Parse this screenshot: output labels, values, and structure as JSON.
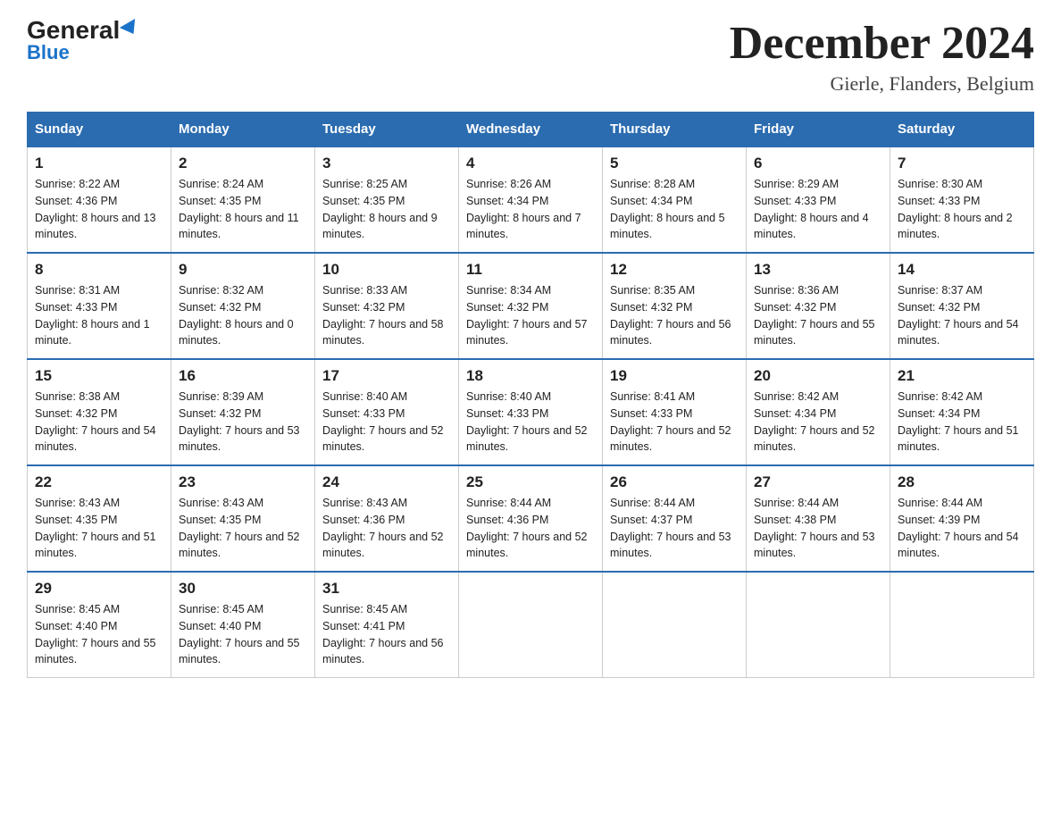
{
  "logo": {
    "general": "General",
    "blue": "Blue"
  },
  "title": "December 2024",
  "subtitle": "Gierle, Flanders, Belgium",
  "days_of_week": [
    "Sunday",
    "Monday",
    "Tuesday",
    "Wednesday",
    "Thursday",
    "Friday",
    "Saturday"
  ],
  "weeks": [
    [
      {
        "day": "1",
        "sunrise": "8:22 AM",
        "sunset": "4:36 PM",
        "daylight": "8 hours and 13 minutes."
      },
      {
        "day": "2",
        "sunrise": "8:24 AM",
        "sunset": "4:35 PM",
        "daylight": "8 hours and 11 minutes."
      },
      {
        "day": "3",
        "sunrise": "8:25 AM",
        "sunset": "4:35 PM",
        "daylight": "8 hours and 9 minutes."
      },
      {
        "day": "4",
        "sunrise": "8:26 AM",
        "sunset": "4:34 PM",
        "daylight": "8 hours and 7 minutes."
      },
      {
        "day": "5",
        "sunrise": "8:28 AM",
        "sunset": "4:34 PM",
        "daylight": "8 hours and 5 minutes."
      },
      {
        "day": "6",
        "sunrise": "8:29 AM",
        "sunset": "4:33 PM",
        "daylight": "8 hours and 4 minutes."
      },
      {
        "day": "7",
        "sunrise": "8:30 AM",
        "sunset": "4:33 PM",
        "daylight": "8 hours and 2 minutes."
      }
    ],
    [
      {
        "day": "8",
        "sunrise": "8:31 AM",
        "sunset": "4:33 PM",
        "daylight": "8 hours and 1 minute."
      },
      {
        "day": "9",
        "sunrise": "8:32 AM",
        "sunset": "4:32 PM",
        "daylight": "8 hours and 0 minutes."
      },
      {
        "day": "10",
        "sunrise": "8:33 AM",
        "sunset": "4:32 PM",
        "daylight": "7 hours and 58 minutes."
      },
      {
        "day": "11",
        "sunrise": "8:34 AM",
        "sunset": "4:32 PM",
        "daylight": "7 hours and 57 minutes."
      },
      {
        "day": "12",
        "sunrise": "8:35 AM",
        "sunset": "4:32 PM",
        "daylight": "7 hours and 56 minutes."
      },
      {
        "day": "13",
        "sunrise": "8:36 AM",
        "sunset": "4:32 PM",
        "daylight": "7 hours and 55 minutes."
      },
      {
        "day": "14",
        "sunrise": "8:37 AM",
        "sunset": "4:32 PM",
        "daylight": "7 hours and 54 minutes."
      }
    ],
    [
      {
        "day": "15",
        "sunrise": "8:38 AM",
        "sunset": "4:32 PM",
        "daylight": "7 hours and 54 minutes."
      },
      {
        "day": "16",
        "sunrise": "8:39 AM",
        "sunset": "4:32 PM",
        "daylight": "7 hours and 53 minutes."
      },
      {
        "day": "17",
        "sunrise": "8:40 AM",
        "sunset": "4:33 PM",
        "daylight": "7 hours and 52 minutes."
      },
      {
        "day": "18",
        "sunrise": "8:40 AM",
        "sunset": "4:33 PM",
        "daylight": "7 hours and 52 minutes."
      },
      {
        "day": "19",
        "sunrise": "8:41 AM",
        "sunset": "4:33 PM",
        "daylight": "7 hours and 52 minutes."
      },
      {
        "day": "20",
        "sunrise": "8:42 AM",
        "sunset": "4:34 PM",
        "daylight": "7 hours and 52 minutes."
      },
      {
        "day": "21",
        "sunrise": "8:42 AM",
        "sunset": "4:34 PM",
        "daylight": "7 hours and 51 minutes."
      }
    ],
    [
      {
        "day": "22",
        "sunrise": "8:43 AM",
        "sunset": "4:35 PM",
        "daylight": "7 hours and 51 minutes."
      },
      {
        "day": "23",
        "sunrise": "8:43 AM",
        "sunset": "4:35 PM",
        "daylight": "7 hours and 52 minutes."
      },
      {
        "day": "24",
        "sunrise": "8:43 AM",
        "sunset": "4:36 PM",
        "daylight": "7 hours and 52 minutes."
      },
      {
        "day": "25",
        "sunrise": "8:44 AM",
        "sunset": "4:36 PM",
        "daylight": "7 hours and 52 minutes."
      },
      {
        "day": "26",
        "sunrise": "8:44 AM",
        "sunset": "4:37 PM",
        "daylight": "7 hours and 53 minutes."
      },
      {
        "day": "27",
        "sunrise": "8:44 AM",
        "sunset": "4:38 PM",
        "daylight": "7 hours and 53 minutes."
      },
      {
        "day": "28",
        "sunrise": "8:44 AM",
        "sunset": "4:39 PM",
        "daylight": "7 hours and 54 minutes."
      }
    ],
    [
      {
        "day": "29",
        "sunrise": "8:45 AM",
        "sunset": "4:40 PM",
        "daylight": "7 hours and 55 minutes."
      },
      {
        "day": "30",
        "sunrise": "8:45 AM",
        "sunset": "4:40 PM",
        "daylight": "7 hours and 55 minutes."
      },
      {
        "day": "31",
        "sunrise": "8:45 AM",
        "sunset": "4:41 PM",
        "daylight": "7 hours and 56 minutes."
      },
      null,
      null,
      null,
      null
    ]
  ],
  "labels": {
    "sunrise": "Sunrise:",
    "sunset": "Sunset:",
    "daylight": "Daylight:"
  }
}
